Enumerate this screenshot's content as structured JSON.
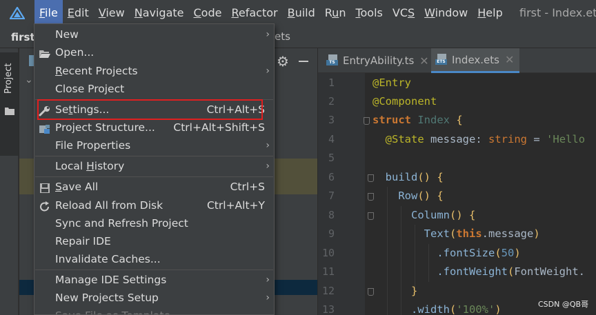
{
  "menubar": {
    "items": [
      {
        "pre": "",
        "mn": "F",
        "post": "ile"
      },
      {
        "pre": "",
        "mn": "E",
        "post": "dit"
      },
      {
        "pre": "",
        "mn": "V",
        "post": "iew"
      },
      {
        "pre": "",
        "mn": "N",
        "post": "avigate"
      },
      {
        "pre": "",
        "mn": "C",
        "post": "ode"
      },
      {
        "pre": "",
        "mn": "R",
        "post": "efactor"
      },
      {
        "pre": "",
        "mn": "B",
        "post": "uild"
      },
      {
        "pre": "R",
        "mn": "u",
        "post": "n"
      },
      {
        "pre": "",
        "mn": "T",
        "post": "ools"
      },
      {
        "pre": "VC",
        "mn": "S",
        "post": ""
      },
      {
        "pre": "",
        "mn": "W",
        "post": "indow"
      },
      {
        "pre": "",
        "mn": "H",
        "post": "elp"
      }
    ],
    "window_title": "first - Index.ets"
  },
  "navbar": {
    "first": "first",
    "last": "ets"
  },
  "tool_window": {
    "label": "Project"
  },
  "editor": {
    "tabs": [
      {
        "label": "EntryAbility.ts",
        "badge": "TS"
      },
      {
        "label": "Index.ets",
        "badge": "ETS"
      }
    ],
    "line_numbers": [
      "1",
      "2",
      "3",
      "4",
      "5",
      "6",
      "7",
      "8",
      "9",
      "10",
      "11",
      "12",
      "13"
    ],
    "code": {
      "l1_ann": "@Entry",
      "l2_ann": "@Component",
      "l3_kw": "struct",
      "l3_cls": "Index",
      "l3_brace": "{",
      "l4_ann": "@State",
      "l4_name": "message:",
      "l4_type": "string",
      "l4_eq": "=",
      "l4_str": "'Hello",
      "l6_fn": "build",
      "l6_paren": "()",
      "l6_brace": "{",
      "l7_fn": "Row",
      "l7_paren": "()",
      "l7_brace": "{",
      "l8_fn": "Column",
      "l8_paren": "()",
      "l8_brace": "{",
      "l9_fn": "Text",
      "l9_open": "(",
      "l9_this": "this",
      "l9_dot": ".",
      "l9_prop": "message",
      "l9_close": ")",
      "l10_method": ".fontSize",
      "l10_open": "(",
      "l10_num": "50",
      "l10_close": ")",
      "l11_method": ".fontWeight",
      "l11_open": "(",
      "l11_arg": "FontWeight.",
      "l12_brace": "}",
      "l13_method": ".width",
      "l13_open": "(",
      "l13_str": "'100%'",
      "l13_close": ")"
    }
  },
  "file_menu": {
    "items": [
      {
        "id": "new",
        "pre": "",
        "mn": "",
        "post": "New",
        "shortcut": "",
        "submenu": true
      },
      {
        "id": "open",
        "pre": "",
        "mn": "",
        "post": "Open...",
        "shortcut": "",
        "submenu": false
      },
      {
        "id": "recent",
        "pre": "",
        "mn": "R",
        "post": "ecent Projects",
        "shortcut": "",
        "submenu": true
      },
      {
        "id": "close",
        "pre": "",
        "mn": "",
        "post": "Close Project",
        "shortcut": "",
        "submenu": false
      },
      {
        "id": "settings",
        "pre": "Se",
        "mn": "t",
        "post": "tings...",
        "shortcut": "Ctrl+Alt+S",
        "submenu": false
      },
      {
        "id": "structure",
        "pre": "",
        "mn": "",
        "post": "Project Structure...",
        "shortcut": "Ctrl+Alt+Shift+S",
        "submenu": false
      },
      {
        "id": "props",
        "pre": "",
        "mn": "",
        "post": "File Properties",
        "shortcut": "",
        "submenu": true
      },
      {
        "id": "history",
        "pre": "Local ",
        "mn": "H",
        "post": "istory",
        "shortcut": "",
        "submenu": true
      },
      {
        "id": "saveall",
        "pre": "",
        "mn": "S",
        "post": "ave All",
        "shortcut": "Ctrl+S",
        "submenu": false
      },
      {
        "id": "reload",
        "pre": "",
        "mn": "",
        "post": "Reload All from Disk",
        "shortcut": "Ctrl+Alt+Y",
        "submenu": false
      },
      {
        "id": "sync",
        "pre": "",
        "mn": "",
        "post": "Sync and Refresh Project",
        "shortcut": "",
        "submenu": false
      },
      {
        "id": "repair",
        "pre": "",
        "mn": "",
        "post": "Repair IDE",
        "shortcut": "",
        "submenu": false
      },
      {
        "id": "invalidate",
        "pre": "",
        "mn": "",
        "post": "Invalidate Caches...",
        "shortcut": "",
        "submenu": false
      },
      {
        "id": "manage",
        "pre": "",
        "mn": "",
        "post": "Manage IDE Settings",
        "shortcut": "",
        "submenu": true
      },
      {
        "id": "newsetup",
        "pre": "",
        "mn": "",
        "post": "New Projects Setup",
        "shortcut": "",
        "submenu": true
      },
      {
        "id": "template",
        "pre": "",
        "mn": "",
        "post": "Save File as Template...",
        "shortcut": "",
        "submenu": false
      }
    ],
    "highlighted_item": "Settings..."
  },
  "watermark": "CSDN @QB哥",
  "colors": {
    "accent": "#4b6eaf",
    "highlight_box": "#e02020",
    "tab_underline": "#4a88c7"
  }
}
